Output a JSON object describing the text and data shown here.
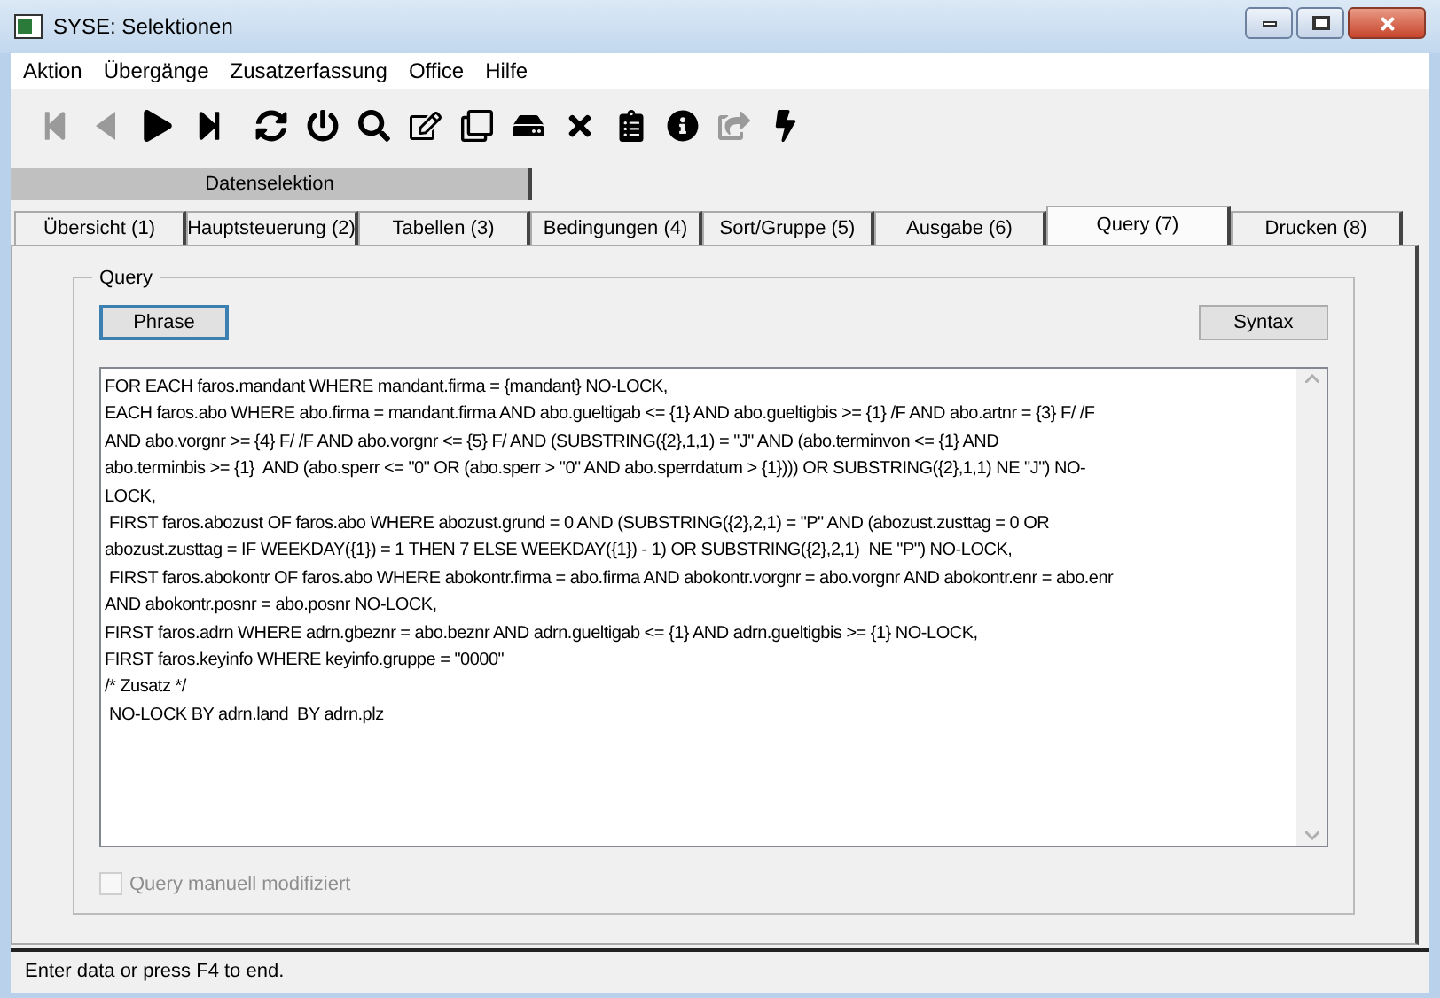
{
  "window": {
    "title": "SYSE: Selektionen"
  },
  "menu": [
    "Aktion",
    "Übergänge",
    "Zusatzerfassung",
    "Office",
    "Hilfe"
  ],
  "toolbar": [
    {
      "disabled": true
    },
    {
      "disabled": true
    },
    {
      "disabled": false
    },
    {
      "disabled": false
    },
    {
      "disabled": false
    },
    {
      "disabled": false
    },
    {
      "disabled": false
    },
    {
      "disabled": false
    },
    {
      "disabled": false
    },
    {
      "disabled": false
    },
    {
      "disabled": false
    },
    {
      "disabled": false
    },
    {
      "disabled": false
    },
    {
      "disabled": true
    },
    {
      "disabled": false
    }
  ],
  "section_header": "Datenselektion",
  "tabs": [
    {
      "label": "Übersicht (1)",
      "selected": false
    },
    {
      "label": "Hauptsteuerung (2)",
      "selected": false
    },
    {
      "label": "Tabellen (3)",
      "selected": false
    },
    {
      "label": "Bedingungen (4)",
      "selected": false
    },
    {
      "label": "Sort/Gruppe (5)",
      "selected": false
    },
    {
      "label": "Ausgabe (6)",
      "selected": false
    },
    {
      "label": "Query (7)",
      "selected": true
    },
    {
      "label": "Drucken (8)",
      "selected": false
    }
  ],
  "group": {
    "title": "Query",
    "buttons": [
      {
        "label": "Phrase",
        "focused": true
      },
      {
        "label": "Syntax",
        "focused": false
      }
    ],
    "query_lines": [
      "FOR EACH faros.mandant WHERE mandant.firma = {mandant} NO-LOCK,",
      "EACH faros.abo WHERE abo.firma = mandant.firma AND abo.gueltigab <= {1} AND abo.gueltigbis >= {1} /F AND abo.artnr = {3} F/ /F",
      "AND abo.vorgnr >= {4} F/ /F AND abo.vorgnr <= {5} F/ AND (SUBSTRING({2},1,1) = \"J\" AND (abo.terminvon <= {1} AND",
      "abo.terminbis >= {1}  AND (abo.sperr <= \"0\" OR (abo.sperr > \"0\" AND abo.sperrdatum > {1}))) OR SUBSTRING({2},1,1) NE \"J\") NO-",
      "LOCK,",
      " FIRST faros.abozust OF faros.abo WHERE abozust.grund = 0 AND (SUBSTRING({2},2,1) = \"P\" AND (abozust.zusttag = 0 OR",
      "abozust.zusttag = IF WEEKDAY({1}) = 1 THEN 7 ELSE WEEKDAY({1}) - 1) OR SUBSTRING({2},2,1)  NE \"P\") NO-LOCK,",
      " FIRST faros.abokontr OF faros.abo WHERE abokontr.firma = abo.firma AND abokontr.vorgnr = abo.vorgnr AND abokontr.enr = abo.enr",
      "AND abokontr.posnr = abo.posnr NO-LOCK,",
      "FIRST faros.adrn WHERE adrn.gbeznr = abo.beznr AND adrn.gueltigab <= {1} AND adrn.gueltigbis >= {1} NO-LOCK,",
      "FIRST faros.keyinfo WHERE keyinfo.gruppe = \"0000\"",
      "/* Zusatz */",
      " NO-LOCK BY adrn.land  BY adrn.plz"
    ],
    "checkbox": {
      "label": "Query manuell modifiziert",
      "checked": false,
      "disabled": true
    }
  },
  "status_bar": "Enter data or press F4 to end."
}
